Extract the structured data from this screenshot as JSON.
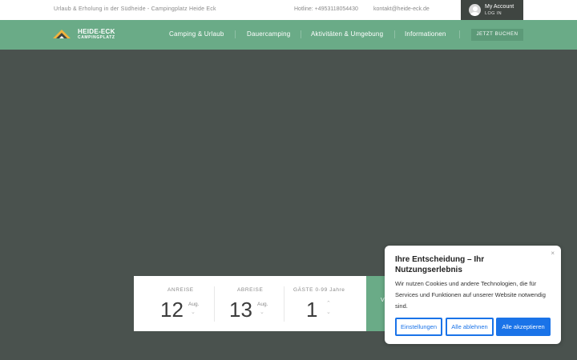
{
  "topbar": {
    "tagline": "Urlaub & Erholung in der Südheide - Campingplatz Heide Eck",
    "hotline": "Hotline: +4953118054430",
    "email": "kontakt@heide-eck.de",
    "account_title": "My Account",
    "account_login": "LOG IN"
  },
  "logo": {
    "line1": "HEIDE-ECK",
    "line2": "CAMPINGPLATZ"
  },
  "nav": {
    "items": [
      "Camping & Urlaub",
      "Dauercamping",
      "Aktivitäten & Umgebung",
      "Informationen"
    ],
    "book_label": "JETZT BUCHEN"
  },
  "booking": {
    "arrival": {
      "label": "ANREISE",
      "day": "12",
      "month": "Aug."
    },
    "departure": {
      "label": "ABREISE",
      "day": "13",
      "month": "Aug."
    },
    "guests": {
      "label": "GÄSTE 0-99 Jahre",
      "value": "1"
    },
    "search_partial": "V"
  },
  "cookie": {
    "title": "Ihre Entscheidung – Ihr Nutzungserlebnis",
    "text": "Wir nutzen Cookies und andere Technologien, die für Services und Funktionen auf unserer Website notwendig sind.",
    "btn_settings": "Einstellungen",
    "btn_reject": "Alle ablehnen",
    "btn_accept": "Alle akzeptieren",
    "close_glyph": "×"
  },
  "colors": {
    "hero_bg": "#4a524e",
    "nav_green": "#6aab87",
    "account_bg": "#3f4541",
    "cookie_blue": "#1a73e8"
  },
  "icons": {
    "avatar": "user-avatar-icon",
    "logo": "tent-mountain-icon",
    "chevron_down": "chevron-down-icon",
    "chevron_up": "chevron-up-icon",
    "close": "close-icon"
  }
}
